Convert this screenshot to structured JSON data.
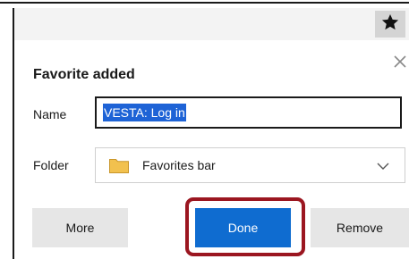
{
  "dialog": {
    "title": "Favorite added",
    "name_label": "Name",
    "name_value": "VESTA: Log in",
    "folder_label": "Folder",
    "folder_value": "Favorites bar",
    "buttons": {
      "more": "More",
      "done": "Done",
      "remove": "Remove"
    }
  },
  "icons": {
    "toolbar": "star-icon",
    "close": "close-icon",
    "folder": "folder-icon",
    "dropdown": "chevron-down-icon"
  },
  "colors": {
    "primary_button": "#0f6cd0",
    "text_selection": "#1e63d6",
    "highlight_ring": "#9b1620",
    "secondary_button": "#e6e6e6",
    "folder_icon": "#f2c14e"
  }
}
